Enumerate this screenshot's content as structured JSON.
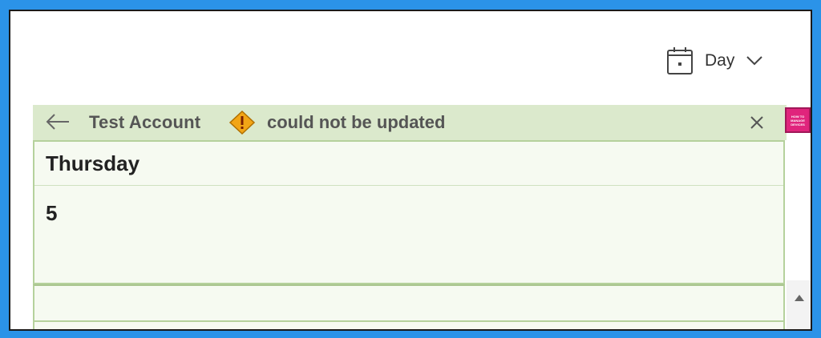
{
  "toolbar": {
    "view_label": "Day"
  },
  "notice": {
    "account_name": "Test Account",
    "message": "could not be updated"
  },
  "day": {
    "name": "Thursday",
    "number": "5"
  },
  "logo": {
    "line1": "HOW TO",
    "line2": "MANAGE",
    "line3": "DEVICES"
  },
  "colors": {
    "frame": "#2b93e8",
    "notice_bg": "#dbe9cc",
    "panel_border": "#b5d19c",
    "warning": "#f2a516"
  },
  "icons": [
    "calendar-icon",
    "chevron-down-icon",
    "back-arrow-icon",
    "warning-icon",
    "close-icon",
    "scroll-up-icon"
  ]
}
